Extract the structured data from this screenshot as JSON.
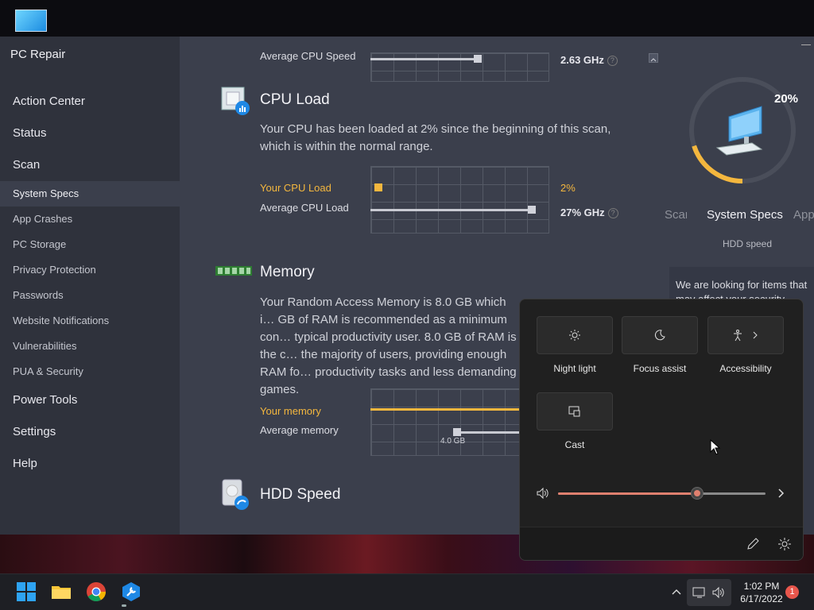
{
  "app": {
    "title": "PC Repair",
    "nav": [
      {
        "label": "Action Center",
        "type": "main"
      },
      {
        "label": "Status",
        "type": "main"
      },
      {
        "label": "Scan",
        "type": "main"
      },
      {
        "label": "System Specs",
        "type": "sub",
        "active": true
      },
      {
        "label": "App Crashes",
        "type": "sub"
      },
      {
        "label": "PC Storage",
        "type": "sub"
      },
      {
        "label": "Privacy Protection",
        "type": "sub"
      },
      {
        "label": "Passwords",
        "type": "sub"
      },
      {
        "label": "Website Notifications",
        "type": "sub"
      },
      {
        "label": "Vulnerabilities",
        "type": "sub"
      },
      {
        "label": "PUA & Security",
        "type": "sub"
      },
      {
        "label": "Power Tools",
        "type": "main"
      },
      {
        "label": "Settings",
        "type": "main"
      },
      {
        "label": "Help",
        "type": "main"
      }
    ]
  },
  "cpu_speed": {
    "avg_label": "Average CPU Speed",
    "avg_value": "2.63 GHz",
    "avg_level": 0.6
  },
  "cpu_load": {
    "title": "CPU Load",
    "description": "Your CPU has been loaded at 2% since the beginning of this scan, which is within the normal range.",
    "your_label": "Your CPU Load",
    "your_value": "2%",
    "your_level": 0.02,
    "avg_label": "Average CPU Load",
    "avg_value": "27% GHz",
    "avg_level": 0.9
  },
  "memory": {
    "title": "Memory",
    "description": "Your Random Access Memory is 8.0 GB which i… GB of RAM is recommended as a minimum con… typical productivity user. 8.0 GB of RAM is the c… the majority of users, providing enough RAM fo… productivity tasks and less demanding games.",
    "your_label": "Your memory",
    "avg_label": "Average memory",
    "avg_value": "4.0 GB"
  },
  "hdd": {
    "title": "HDD Speed"
  },
  "scan_panel": {
    "progress_text": "20%",
    "progress": 0.2,
    "carousel_prev": "Scan",
    "carousel_current": "System Specs",
    "carousel_next": "App",
    "caption": "HDD speed",
    "looking_text": "We are looking for items that may affect your security"
  },
  "quick_settings": {
    "tiles": [
      {
        "label": "Night light",
        "icon": "brightness-icon"
      },
      {
        "label": "Focus assist",
        "icon": "moon-icon"
      },
      {
        "label": "Accessibility",
        "icon": "accessibility-icon"
      },
      {
        "label": "Cast",
        "icon": "cast-icon"
      }
    ],
    "volume_level": 0.67
  },
  "taskbar": {
    "time": "1:02 PM",
    "date": "6/17/2022",
    "notifications": "1"
  },
  "colors": {
    "accent": "#f4b73e",
    "sidebar": "#2f323c",
    "content": "#3b3f4c",
    "volume": "#e0806f"
  }
}
